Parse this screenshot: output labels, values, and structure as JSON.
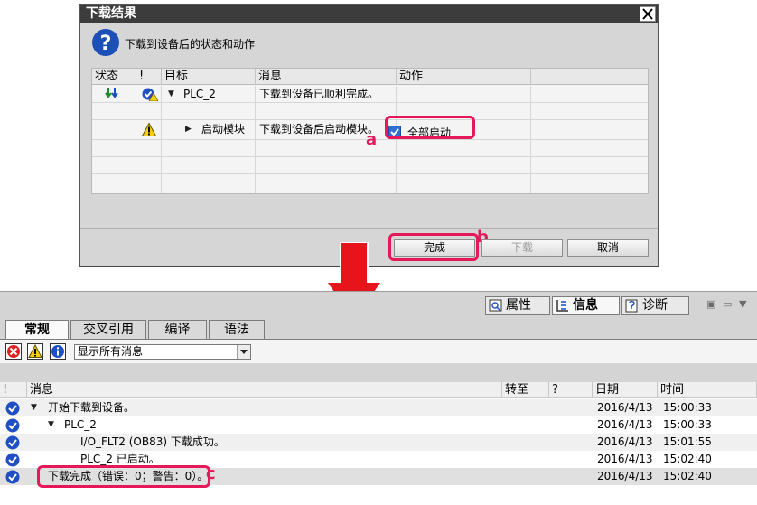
{
  "dialog": {
    "title": "下载结果",
    "prompt": "下载到设备后的状态和动作",
    "columns": [
      "状态",
      "!",
      "目标",
      "消息",
      "动作"
    ],
    "rows": [
      {
        "target": "PLC_2",
        "message": "下载到设备已顺利完成。",
        "action": ""
      },
      {
        "target": "",
        "message": "",
        "action": ""
      },
      {
        "target": "启动模块",
        "message": "下载到设备后启动模块。",
        "action": "全部启动"
      }
    ],
    "buttons": {
      "finish": "完成",
      "download": "下载",
      "cancel": "取消"
    },
    "markers": {
      "a": "a",
      "b": "b"
    }
  },
  "inspector": {
    "tabs": {
      "properties": "属性",
      "info": "信息",
      "diagnostics": "诊断"
    },
    "subtabs": [
      "常规",
      "交叉引用",
      "编译",
      "语法"
    ],
    "filter": {
      "selected": "显示所有消息"
    },
    "columns": {
      "bang": "!",
      "message": "消息",
      "goto": "转至",
      "question": "?",
      "date": "日期",
      "time": "时间"
    },
    "rows": [
      {
        "message": "开始下载到设备。",
        "date": "2016/4/13",
        "time": "15:00:33"
      },
      {
        "message": "PLC_2",
        "date": "2016/4/13",
        "time": "15:00:33"
      },
      {
        "message": "I/O_FLT2 (OB83) 下载成功。",
        "date": "2016/4/13",
        "time": "15:01:55"
      },
      {
        "message": "PLC_2 已启动。",
        "date": "2016/4/13",
        "time": "15:02:40"
      },
      {
        "message": "下载完成（错误：0；警告：0）。",
        "date": "2016/4/13",
        "time": "15:02:40"
      }
    ],
    "marker_c": "c"
  },
  "colors": {
    "highlight": "#e5195a",
    "arrow": "#e8141c",
    "accent": "#2f6fd0"
  },
  "icons": [
    "question-icon",
    "close-icon",
    "download-arrows-icon",
    "status-check-warning-icon",
    "warning-icon",
    "check-circle-icon",
    "error-icon",
    "info-icon"
  ]
}
